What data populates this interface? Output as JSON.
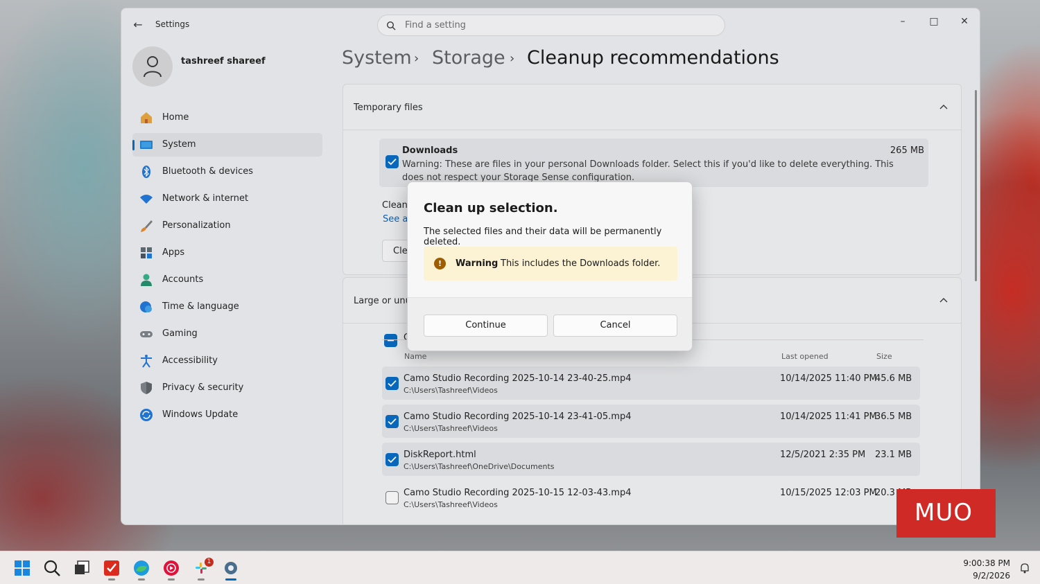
{
  "window": {
    "app_title": "Settings",
    "search_placeholder": "Find a setting"
  },
  "user": {
    "name": "tashreef shareef"
  },
  "nav": {
    "items": [
      {
        "label": "Home",
        "icon": "home-icon"
      },
      {
        "label": "System",
        "icon": "system-icon",
        "active": true
      },
      {
        "label": "Bluetooth & devices",
        "icon": "bluetooth-icon"
      },
      {
        "label": "Network & internet",
        "icon": "wifi-icon"
      },
      {
        "label": "Personalization",
        "icon": "brush-icon"
      },
      {
        "label": "Apps",
        "icon": "apps-icon"
      },
      {
        "label": "Accounts",
        "icon": "account-icon"
      },
      {
        "label": "Time & language",
        "icon": "globe-clock-icon"
      },
      {
        "label": "Gaming",
        "icon": "controller-icon"
      },
      {
        "label": "Accessibility",
        "icon": "accessibility-icon"
      },
      {
        "label": "Privacy & security",
        "icon": "shield-icon"
      },
      {
        "label": "Windows Update",
        "icon": "update-icon"
      }
    ]
  },
  "breadcrumb": {
    "level1": "System",
    "level2": "Storage",
    "current": "Cleanup recommendations"
  },
  "temp_files": {
    "title": "Temporary files",
    "downloads_title": "Downloads",
    "downloads_size": "265 MB",
    "downloads_desc": "Warning: These are files in your personal Downloads folder. Select this if you'd like to delete everything. This does not respect your Storage Sense configuration.",
    "partial_line1": "Cleanu",
    "partial_link": "See ac",
    "partial_button": "Cle"
  },
  "large_files": {
    "title": "Large or unu",
    "partial_header": "C",
    "columns": {
      "name": "Name",
      "last_opened": "Last opened",
      "size": "Size"
    },
    "rows": [
      {
        "name": "Camo Studio Recording 2025-10-14 23-40-25.mp4",
        "path": "C:\\Users\\Tashreef\\Videos",
        "date": "10/14/2025 11:40 PM",
        "size": "45.6 MB",
        "checked": true
      },
      {
        "name": "Camo Studio Recording 2025-10-14 23-41-05.mp4",
        "path": "C:\\Users\\Tashreef\\Videos",
        "date": "10/14/2025 11:41 PM",
        "size": "36.5 MB",
        "checked": true
      },
      {
        "name": "DiskReport.html",
        "path": "C:\\Users\\Tashreef\\OneDrive\\Documents",
        "date": "12/5/2021 2:35 PM",
        "size": "23.1 MB",
        "checked": true
      },
      {
        "name": "Camo Studio Recording 2025-10-15 12-03-43.mp4",
        "path": "C:\\Users\\Tashreef\\Videos",
        "date": "10/15/2025 12:03 PM",
        "size": "20.3 MB",
        "checked": false
      }
    ]
  },
  "dialog": {
    "title": "Clean up selection.",
    "message": "The selected files and their data will be permanently deleted.",
    "warning_label": "Warning",
    "warning_text": "This includes the Downloads folder.",
    "continue_label": "Continue",
    "cancel_label": "Cancel"
  },
  "watermark": "MUO",
  "taskbar": {
    "time": "9:00:38 PM",
    "date": "9/2/2026",
    "slack_badge": "1",
    "icons": [
      "start-icon",
      "search-icon",
      "task-view-icon",
      "todoist-icon",
      "edge-icon",
      "youtube-music-icon",
      "slack-icon",
      "settings-icon"
    ]
  },
  "colors": {
    "accent": "#0067c0",
    "warning_bg": "#fbf3d4",
    "warning_icon": "#9d5d00",
    "watermark": "#cf2a25"
  }
}
